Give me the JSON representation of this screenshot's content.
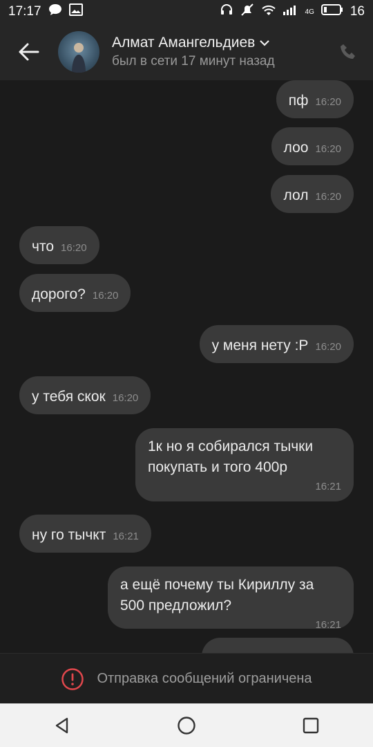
{
  "status_bar": {
    "time": "17:17",
    "battery": "16",
    "network": "4G"
  },
  "header": {
    "contact_name": "Алмат Амангельдиев",
    "last_seen": "был в сети 17 минут назад"
  },
  "messages": [
    {
      "side": "out",
      "text": "пф",
      "time": "16:20"
    },
    {
      "side": "out",
      "text": "лоо",
      "time": "16:20"
    },
    {
      "side": "out",
      "text": "лол",
      "time": "16:20"
    },
    {
      "side": "in",
      "text": "что",
      "time": "16:20"
    },
    {
      "side": "in",
      "text": "дорого?",
      "time": "16:20"
    },
    {
      "side": "out",
      "text": "у меня нету :P",
      "time": "16:20"
    },
    {
      "side": "in",
      "text": "у тебя скок",
      "time": "16:20"
    },
    {
      "side": "out",
      "text": "1к но я собирался тычки\nпокупать и того 400р",
      "time": "16:21"
    },
    {
      "side": "in",
      "text": "ну го тычкт",
      "time": "16:21"
    },
    {
      "side": "out",
      "text": "а ещё почему ты Кириллу за\n500 предложил?",
      "time": "16:21"
    }
  ],
  "restriction": {
    "text": "Отправка сообщений ограничена"
  },
  "colors": {
    "bubble": "#3a3a3a",
    "background": "#1b1b1b",
    "warning": "#e0474c"
  }
}
